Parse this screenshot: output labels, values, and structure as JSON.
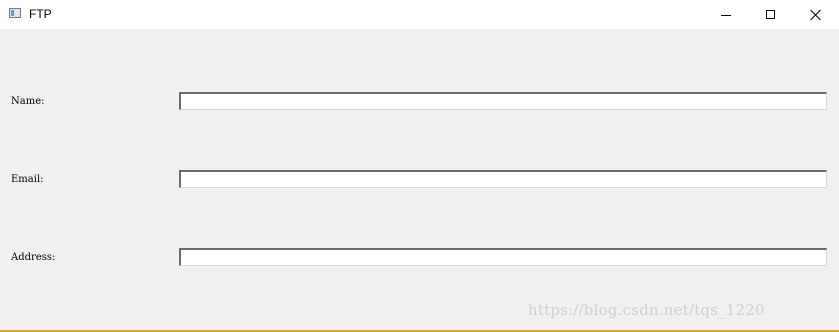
{
  "window": {
    "title": "FTP",
    "icon": "app-window-icon",
    "controls": {
      "minimize_icon": "minimize-icon",
      "maximize_icon": "maximize-icon",
      "close_icon": "close-icon"
    }
  },
  "form": {
    "fields": [
      {
        "label": "Name:",
        "value": "",
        "placeholder": ""
      },
      {
        "label": "Email:",
        "value": "",
        "placeholder": ""
      },
      {
        "label": "Address:",
        "value": "",
        "placeholder": ""
      }
    ]
  },
  "watermark": {
    "text": "https://blog.csdn.net/tqs_1220"
  },
  "colors": {
    "titlebar": "#ffffff",
    "background": "#f0f0f0",
    "bottom_border": "#e8a33a"
  }
}
